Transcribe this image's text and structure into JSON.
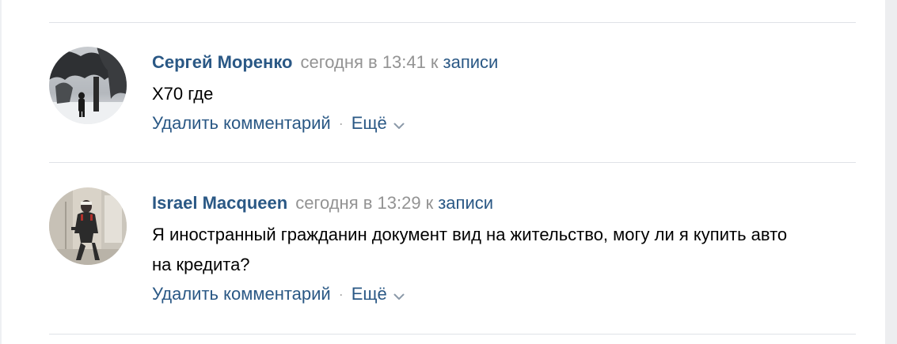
{
  "comments": [
    {
      "author": "Сергей Моренко",
      "time": "сегодня в 13:41",
      "to_label": "к",
      "post_link": "записи",
      "text": "X70 где",
      "delete_label": "Удалить комментарий",
      "separator": "·",
      "more_label": "Ещё"
    },
    {
      "author": "Israel Macqueen",
      "time": "сегодня в 13:29",
      "to_label": "к",
      "post_link": "записи",
      "text": "Я иностранный гражданин документ вид на жительство, могу ли я купить авто на кредита?",
      "delete_label": "Удалить комментарий",
      "separator": "·",
      "more_label": "Ещё"
    }
  ],
  "icons": {
    "more_chevron": "chevron-down-icon"
  },
  "colors": {
    "link": "#2a5885",
    "meta": "#939393",
    "text": "#000000",
    "divider": "#dfe2e7"
  }
}
